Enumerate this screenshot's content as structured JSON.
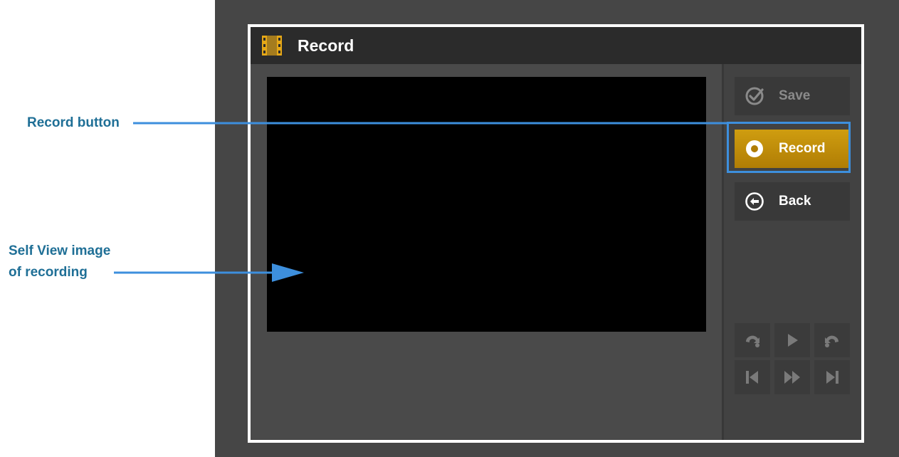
{
  "window": {
    "title": "Record",
    "title_icon": "film-icon"
  },
  "sidebar": {
    "save_label": "Save",
    "record_label": "Record",
    "back_label": "Back",
    "save_icon": "check-circle-icon",
    "record_icon": "record-dot-icon",
    "back_icon": "back-arrow-icon"
  },
  "playback_controls": [
    "rewind-icon",
    "play-icon",
    "forward-icon",
    "skip-back-icon",
    "fast-forward-icon",
    "skip-end-icon"
  ],
  "annotations": {
    "record_button": "Record button",
    "self_view_line1": "Self View image",
    "self_view_line2": "of recording"
  },
  "colors": {
    "accent_gold": "#c08a0a",
    "annotation_blue": "#3d8fdd",
    "annotation_text": "#1f6f96",
    "panel_dark": "#2b2b2b"
  }
}
